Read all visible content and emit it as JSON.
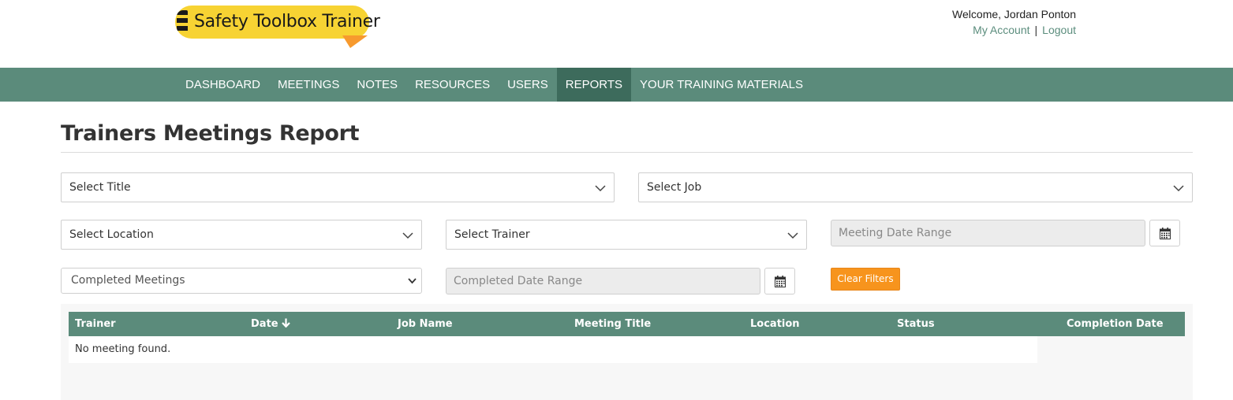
{
  "brand": {
    "name": "Safety Toolbox Trainer"
  },
  "account": {
    "welcome": "Welcome, Jordan Ponton",
    "my_account": "My Account",
    "separator": "|",
    "logout": "Logout"
  },
  "nav": {
    "items": [
      {
        "label": "DASHBOARD",
        "active": false
      },
      {
        "label": "MEETINGS",
        "active": false
      },
      {
        "label": "NOTES",
        "active": false
      },
      {
        "label": "RESOURCES",
        "active": false
      },
      {
        "label": "USERS",
        "active": false
      },
      {
        "label": "REPORTS",
        "active": true
      },
      {
        "label": "YOUR TRAINING MATERIALS",
        "active": false
      }
    ]
  },
  "page": {
    "title": "Trainers Meetings Report"
  },
  "filters": {
    "title_select": "Select Title",
    "job_select": "Select Job",
    "location_select": "Select Location",
    "trainer_select": "Select Trainer",
    "meeting_date_range_placeholder": "Meeting Date Range",
    "completion_select": "Completed Meetings",
    "completed_date_range_placeholder": "Completed Date Range",
    "clear_filters": "Clear Filters"
  },
  "table": {
    "columns": [
      "Trainer",
      "Date",
      "Job Name",
      "Meeting Title",
      "Location",
      "Status",
      "Completion Date"
    ],
    "sort_column": "Date",
    "sort_direction": "descending",
    "empty_message": "No meeting found."
  },
  "colors": {
    "nav_bg": "#5b8b7b",
    "nav_active": "#3d6b5c",
    "link": "#5b8d7d",
    "button_accent": "#f7941d",
    "logo_yellow": "#f7d333"
  }
}
